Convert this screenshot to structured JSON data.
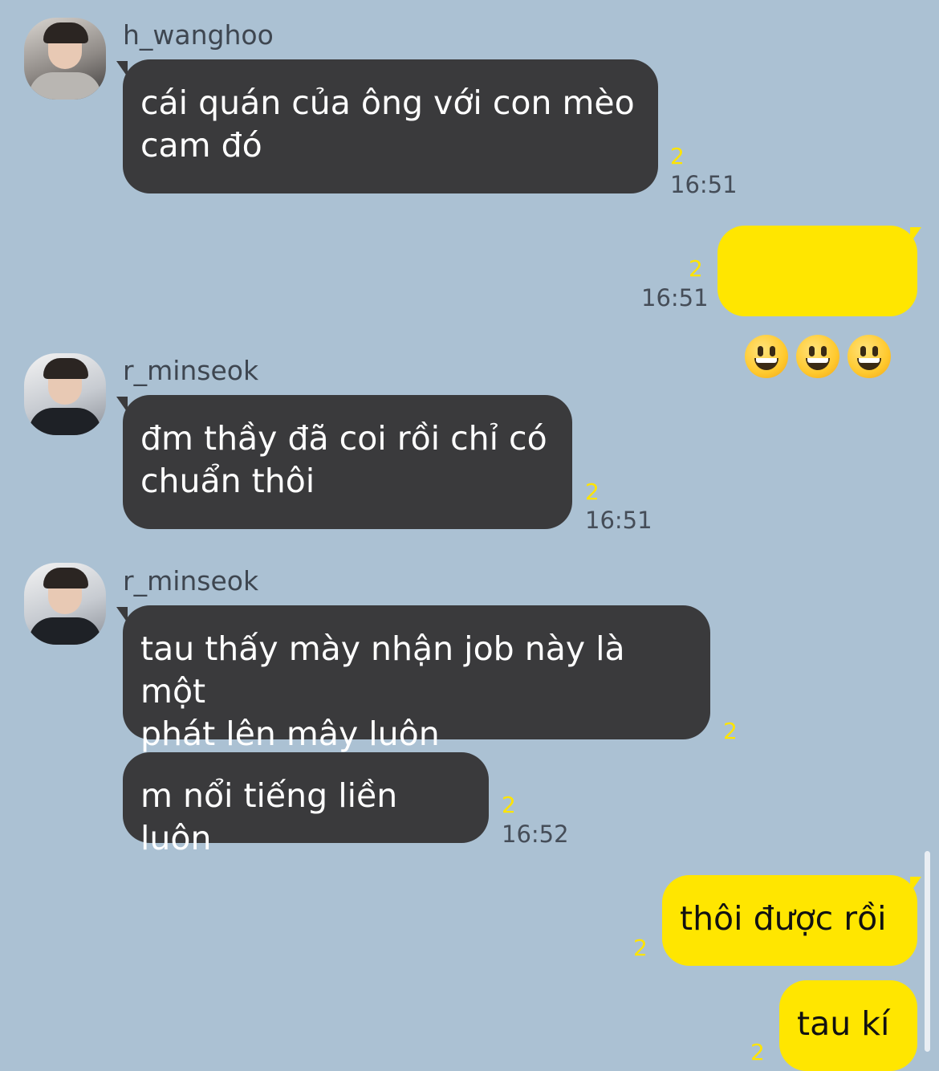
{
  "messages": [
    {
      "sender": "h_wanghoo",
      "text": "cái quán của ông với con mèo\ncam đó",
      "unread": "2",
      "time": "16:51"
    },
    {
      "emoji": [
        "grinning-face",
        "grinning-face",
        "grinning-face"
      ],
      "unread": "2",
      "time": "16:51"
    },
    {
      "sender": "r_minseok",
      "text": "đm thầy đã coi rồi chỉ có\nchuẩn thôi",
      "unread": "2",
      "time": "16:51"
    },
    {
      "sender": "r_minseok",
      "text": "tau thấy mày nhận job này là một\nphát lên mây luôn",
      "unread": "2"
    },
    {
      "text": "m nổi tiếng liền luôn",
      "unread": "2",
      "time": "16:52"
    },
    {
      "text": "thôi được rồi",
      "unread": "2"
    },
    {
      "text": "tau kí",
      "unread": "2"
    }
  ],
  "colors": {
    "background": "#abc1d3",
    "incoming_bubble": "#3a3a3c",
    "outgoing_bubble": "#ffe600",
    "unread_count": "#ffe400"
  }
}
